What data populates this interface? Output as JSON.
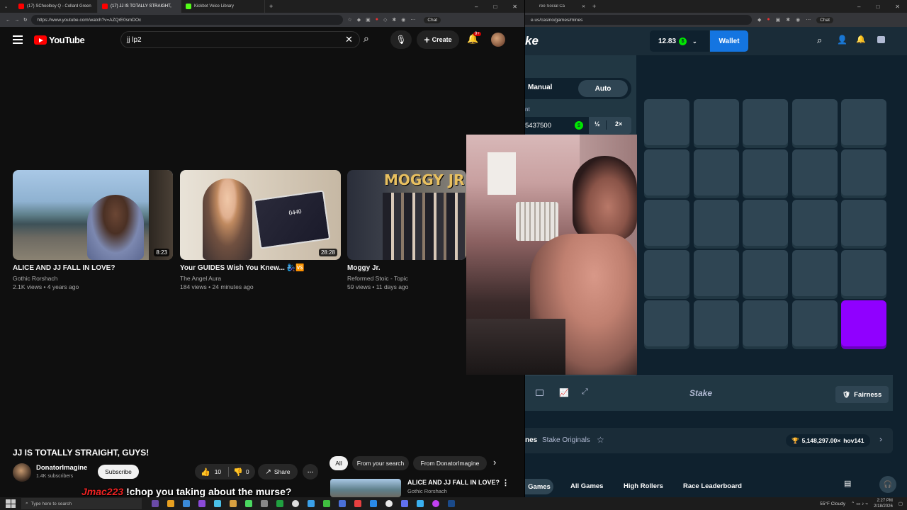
{
  "left_browser": {
    "tabs": [
      {
        "label": "(17) SChoolboy Q - Collard Green",
        "active": false
      },
      {
        "label": "(17) JJ IS TOTALLY STRAIGHT,",
        "active": true
      },
      {
        "label": "Kickbot Voice Library",
        "active": false
      }
    ],
    "url": "https://www.youtube.com/watch?v=AZQrE0smDOc"
  },
  "youtube": {
    "logo_text": "YouTube",
    "search_value": "jj lp2",
    "create_label": "Create",
    "notification_count": "9+",
    "videos": [
      {
        "title": "ALICE AND JJ FALL IN LOVE?",
        "channel": "Gothic Rorshach",
        "meta": "2.1K views • 4 years ago",
        "duration": "8:23"
      },
      {
        "title": "Your GUIDES Wish You Knew... 🧞‍♀️🆚",
        "channel": "The Angel Aura",
        "meta": "184 views • 24 minutes ago",
        "duration": "28:28"
      },
      {
        "title": "Moggy Jr.",
        "channel": "Reformed Stoic - Topic",
        "meta": "59 views • 11 days ago",
        "duration": ""
      }
    ],
    "thumb_text": {
      "card2": "0440",
      "card3": "MOGGY JR"
    },
    "now_playing": {
      "title": "JJ IS TOTALLY STRAIGHT, GUYS!",
      "channel": "DonatorImagine",
      "subscribers": "1.4K subscribers",
      "subscribe_label": "Subscribe",
      "likes": "10",
      "dislikes": "0",
      "share_label": "Share"
    },
    "filter_chips": [
      "All",
      "From your search",
      "From DonatorImagine"
    ],
    "upnext": {
      "title": "ALICE AND JJ FALL IN LOVE?",
      "channel": "Gothic Rorshach"
    }
  },
  "right_browser": {
    "url": "e.us/casino/games/mines",
    "tab_label": "ree Social Ca"
  },
  "stake": {
    "logo_partial": "ke",
    "balance": "12.83",
    "wallet_label": "Wallet",
    "mode_manual": "Manual",
    "mode_auto": "Auto",
    "bet_label_partial": "nt",
    "bet_amount": "5437500",
    "half_label": "½",
    "double_label": "2×",
    "footer_logo": "Stake",
    "fairness_label": "Fairness",
    "game_name_partial": "nes",
    "stake_originals": "Stake Originals",
    "top_win": "5,148,297.00×",
    "top_win_user": "hov141",
    "bottom_tabs": [
      "Games",
      "All Games",
      "High Rollers",
      "Race Leaderboard"
    ],
    "grid_gem_index": 24
  },
  "chat_overlay": {
    "user": "Jmac223",
    "message": "!chop you taking about the murse?"
  },
  "taskbar": {
    "search_placeholder": "Type here to search",
    "weather": "55°F Cloudy",
    "time": "2:27 PM",
    "date": "2/18/2026"
  },
  "colors": {
    "youtube_red": "#ff0000",
    "stake_blue": "#1475e1",
    "stake_bg": "#0f212e",
    "tile": "#2f4553",
    "gem_purple": "#9000ff",
    "balance_green": "#00e701"
  }
}
